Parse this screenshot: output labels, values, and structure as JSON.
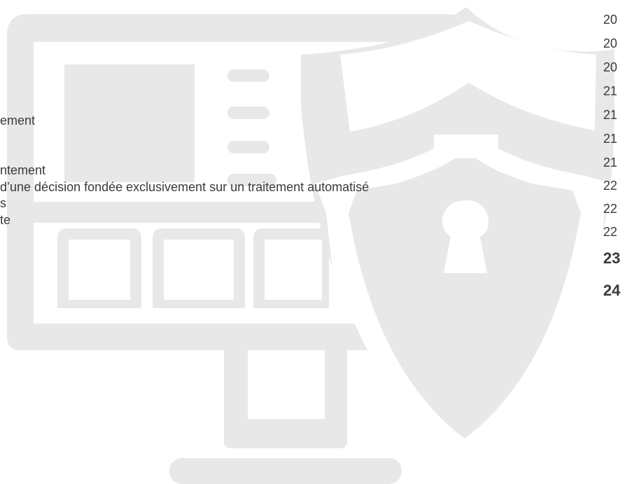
{
  "illustration": {
    "monitor_icon": "monitor-icon",
    "shield_icon": "shield-keyhole-icon",
    "art_color": "#e8e8e8"
  },
  "toc": {
    "entries": [
      "ement",
      "ntement",
      " d’une décision fondée exclusivement sur un traitement automatisé",
      "s",
      "te"
    ],
    "pages": [
      "20",
      "20",
      "20",
      "21",
      "21",
      "21",
      "21",
      "22",
      "22",
      "22",
      "23",
      "24"
    ]
  }
}
